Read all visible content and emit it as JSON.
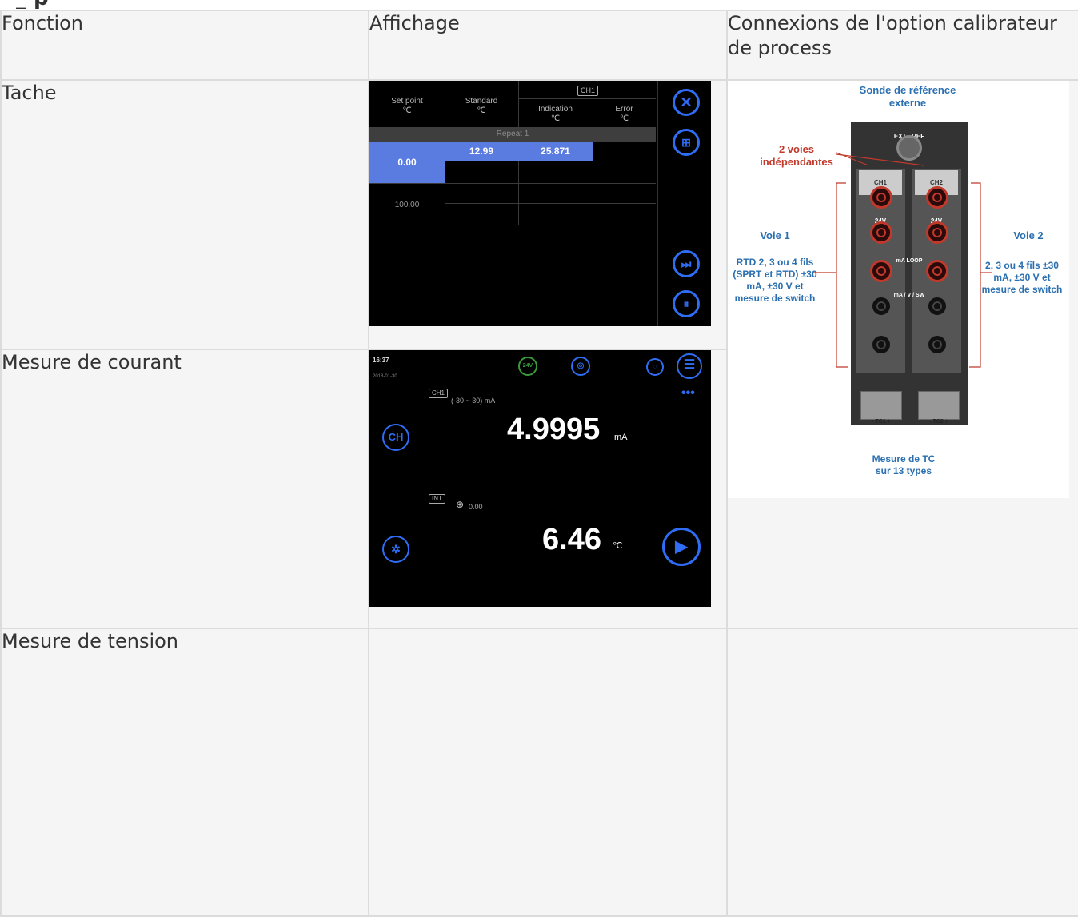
{
  "headers": {
    "function": "Fonction",
    "display": "Affichage",
    "connections": "Connexions de l'option calibrateur de process"
  },
  "rows": [
    {
      "function": "Tache"
    },
    {
      "function": "Mesure de courant"
    },
    {
      "function": "Mesure de tension"
    }
  ],
  "task_screen": {
    "col_setpoint": "Set point",
    "col_setpoint_unit": "℃",
    "col_standard": "Standard",
    "col_standard_unit": "℃",
    "channel_badge": "CH1",
    "col_indication": "Indication",
    "col_indication_unit": "℃",
    "col_error": "Error",
    "col_error_unit": "℃",
    "repeat_label": "Repeat 1",
    "setpoint_1": "0.00",
    "standard_1": "12.99",
    "indication_1": "25.871",
    "setpoint_2": "100.00"
  },
  "current_screen": {
    "time": "16:37",
    "date": "2018-01-30",
    "badge_24v": "24V",
    "channel_badge": "CH1",
    "range": "(-30 ~ 30) mA",
    "value": "4.9995",
    "unit": "mA",
    "int_badge": "INT",
    "int_offset": "0.00",
    "temp_value": "6.46",
    "temp_unit": "℃"
  },
  "diagram": {
    "ext_probe": "Sonde de référence externe",
    "ext_ref": "EXT . REF",
    "independent": "2 voies indépendantes",
    "ch1": "CH1",
    "ch2": "CH2",
    "v24": "24V",
    "ma_loop": "mA LOOP",
    "ma_v_sw": "mA / V / SW",
    "voie1": "Voie 1",
    "voie1_desc": "RTD 2, 3 ou 4 fils (SPRT et RTD) ±30 mA, ±30 V et mesure de switch",
    "voie2": "Voie 2",
    "voie2_desc": "2, 3 ou 4 fils ±30 mA, ±30 V et mesure de switch",
    "tc1": "- TC1 +",
    "tc2": "- TC2 +",
    "tc_measure": "Mesure de TC sur 13 types"
  },
  "colors": {
    "accent_blue": "#2f6df5",
    "selected_cell": "#5a7be0",
    "label_blue": "#2a6fb0",
    "label_red": "#c0392b",
    "table_bg": "#f5f5f5"
  }
}
